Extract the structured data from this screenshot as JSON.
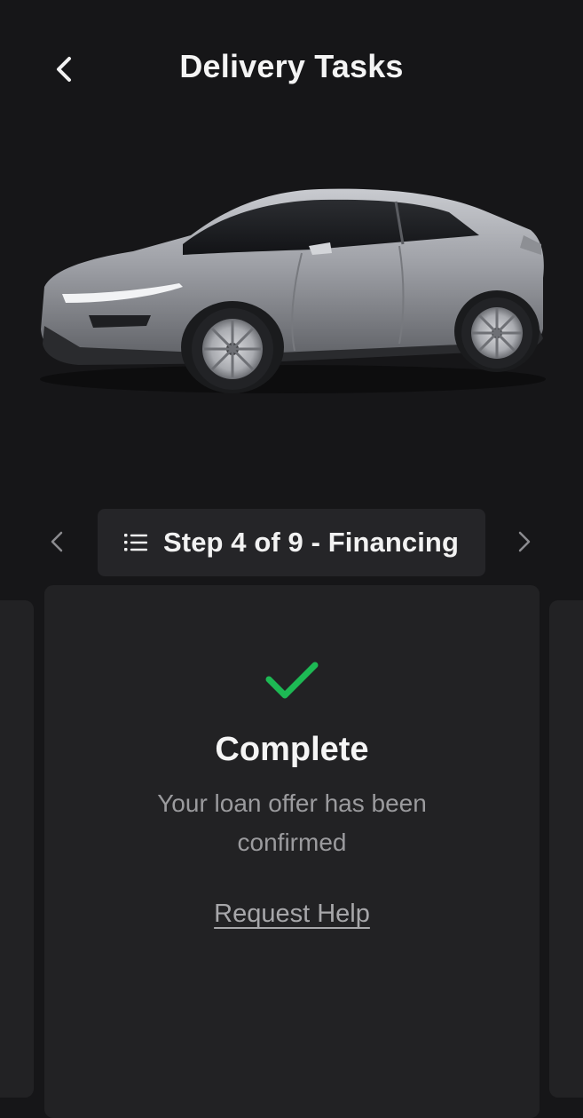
{
  "header": {
    "title": "Delivery Tasks",
    "back_icon": "chevron-left-icon"
  },
  "vehicle": {
    "image": "car-illustration",
    "color": "#9a9ca2"
  },
  "step_selector": {
    "label": "Step 4 of 9 - Financing",
    "list_icon": "list-icon",
    "prev_icon": "chevron-left-icon",
    "next_icon": "chevron-right-icon"
  },
  "task_card": {
    "status_icon": "checkmark-icon",
    "status": "Complete",
    "message": "Your loan offer has been confirmed",
    "help_link": "Request Help"
  },
  "colors": {
    "background": "#161618",
    "card": "#222224",
    "pill": "#252528",
    "success": "#1db954",
    "muted_text": "#9b9b9e"
  }
}
